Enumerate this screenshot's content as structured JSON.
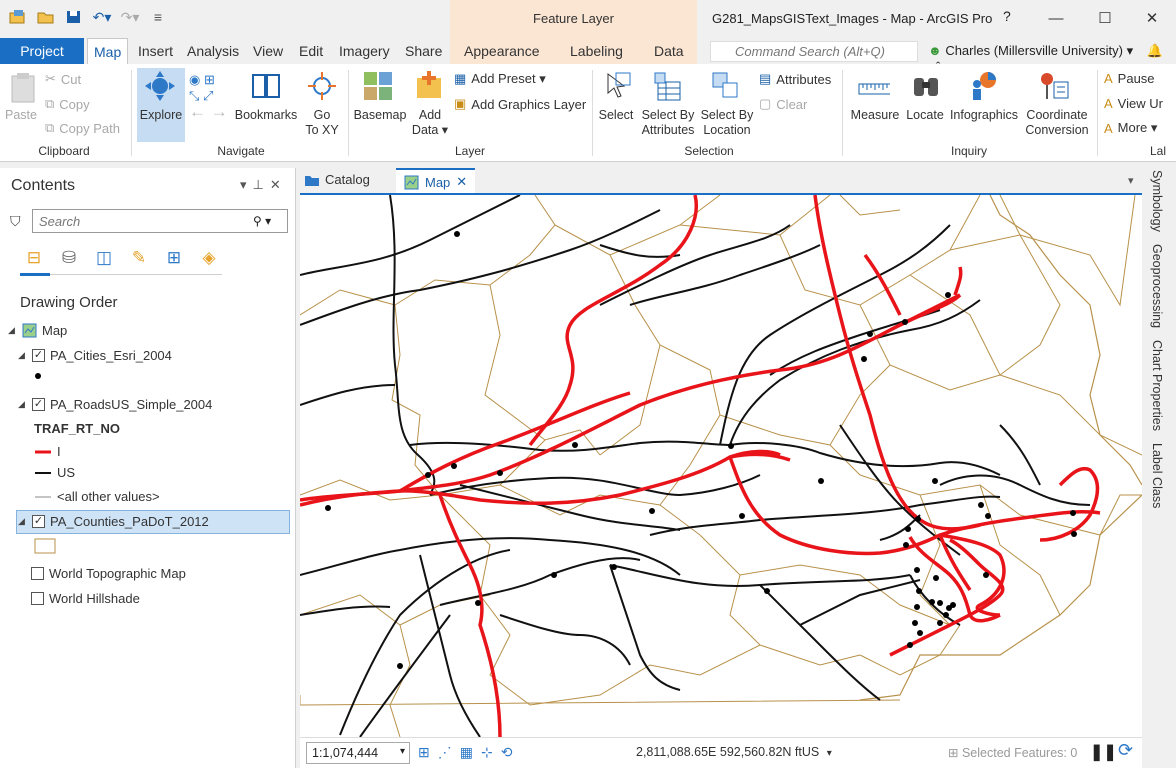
{
  "window": {
    "title": "G281_MapsGISText_Images - Map - ArcGIS Pro",
    "contextual_tab_group": "Feature Layer",
    "help": "?",
    "minimize": "—",
    "maximize": "☐",
    "close": "✕"
  },
  "tabs": [
    {
      "label": "Project"
    },
    {
      "label": "Map"
    },
    {
      "label": "Insert"
    },
    {
      "label": "Analysis"
    },
    {
      "label": "View"
    },
    {
      "label": "Edit"
    },
    {
      "label": "Imagery"
    },
    {
      "label": "Share"
    },
    {
      "label": "Appearance"
    },
    {
      "label": "Labeling"
    },
    {
      "label": "Data"
    }
  ],
  "command_search": {
    "placeholder": "Command Search (Alt+Q)"
  },
  "user": {
    "name": "Charles (Millersville University) ▾"
  },
  "ribbon": {
    "clipboard": {
      "group": "Clipboard",
      "paste": "Paste",
      "cut": "Cut",
      "copy": "Copy",
      "copy_path": "Copy Path"
    },
    "navigate": {
      "group": "Navigate",
      "explore": "Explore",
      "bookmarks": "Bookmarks",
      "goto_a": "Go",
      "goto_b": "To XY"
    },
    "layer": {
      "group": "Layer",
      "basemap": "Basemap",
      "add_data_a": "Add",
      "add_data_b": "Data ▾",
      "add_preset": "Add Preset ▾",
      "add_graphics": "Add Graphics Layer"
    },
    "selection": {
      "group": "Selection",
      "select": "Select",
      "by_attr_a": "Select By",
      "by_attr_b": "Attributes",
      "by_loc_a": "Select By",
      "by_loc_b": "Location",
      "attributes": "Attributes",
      "clear": "Clear"
    },
    "inquiry": {
      "group": "Inquiry",
      "measure": "Measure",
      "locate": "Locate",
      "infographics": "Infographics",
      "coord_a": "Coordinate",
      "coord_b": "Conversion"
    },
    "labeling": {
      "group": "Lal",
      "pause": "Pause",
      "view_un": "View Ur",
      "more": "More ▾"
    }
  },
  "contents": {
    "title": "Contents",
    "search_placeholder": "Search",
    "drawing_order": "Drawing Order",
    "map": "Map",
    "layers": [
      {
        "name": "PA_Cities_Esri_2004",
        "checked": true
      },
      {
        "name": "PA_RoadsUS_Simple_2004",
        "checked": true,
        "field": "TRAF_RT_NO",
        "legend": [
          "I",
          "US",
          "<all other values>"
        ]
      },
      {
        "name": "PA_Counties_PaDoT_2012",
        "checked": true
      },
      {
        "name": "World Topographic Map",
        "checked": false
      },
      {
        "name": "World Hillshade",
        "checked": false
      }
    ]
  },
  "views": {
    "catalog": "Catalog",
    "map": "Map"
  },
  "status": {
    "scale": "1:1,074,444",
    "coords": "2,811,088.65E 592,560.82N ftUS",
    "selected": "Selected Features: 0"
  },
  "side_panes": [
    "Symbology",
    "Geoprocessing",
    "Chart Properties",
    "Label Class"
  ],
  "colors": {
    "accent": "#1a6ec4",
    "interstate": "#e8141a",
    "us_route": "#111111",
    "county": "#b8914a"
  }
}
